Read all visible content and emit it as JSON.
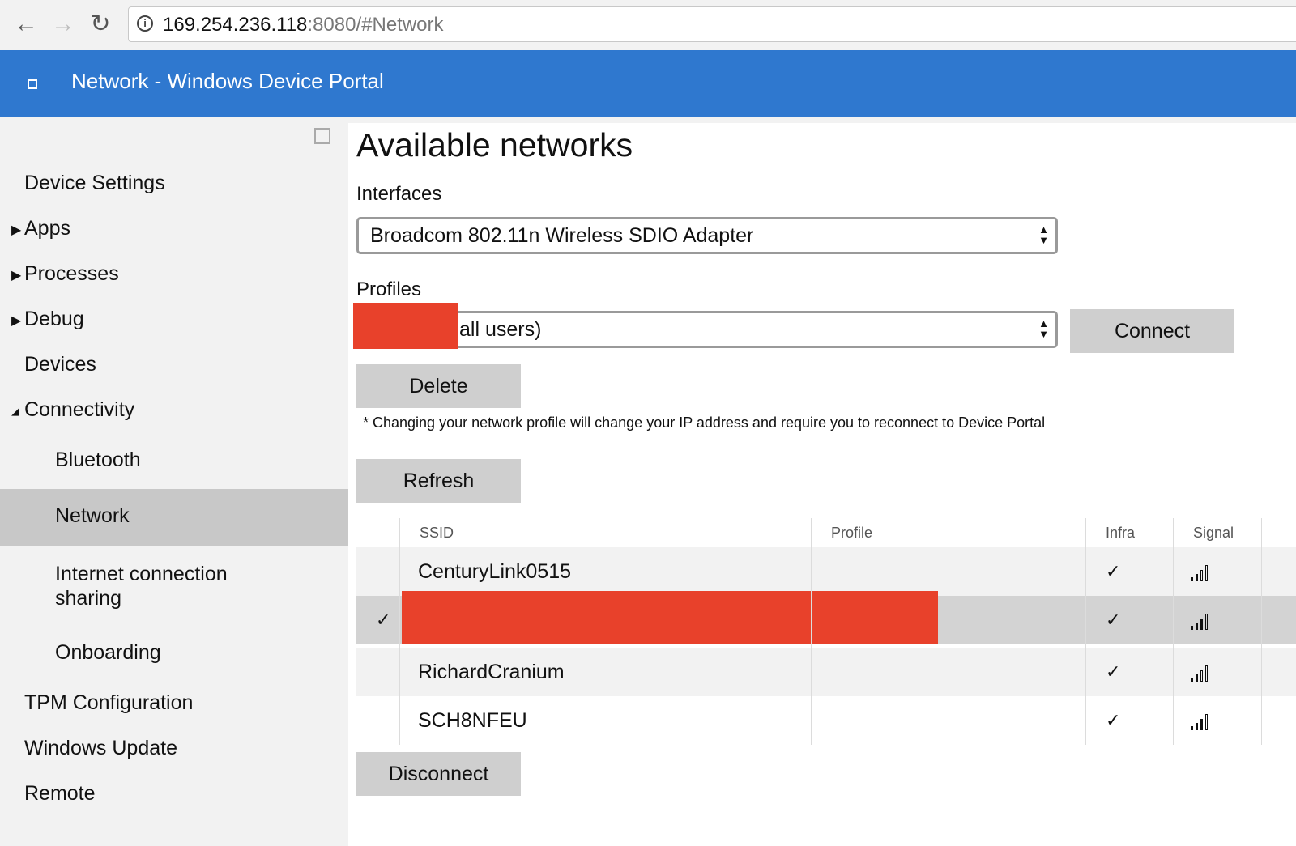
{
  "browser": {
    "url_host": "169.254.236.118",
    "url_rest": ":8080/#Network",
    "back_icon": "←",
    "forward_icon": "→",
    "reload_icon": "↻",
    "info_icon": "i"
  },
  "header": {
    "title": "Network - Windows Device Portal",
    "color": "#2f78cf"
  },
  "sidebar": {
    "items": [
      {
        "label": "Device Settings",
        "arrow": ""
      },
      {
        "label": "Apps",
        "arrow": "▶"
      },
      {
        "label": "Processes",
        "arrow": "▶"
      },
      {
        "label": "Debug",
        "arrow": "▶"
      },
      {
        "label": "Devices",
        "arrow": ""
      },
      {
        "label": "Connectivity",
        "arrow": "◢"
      },
      {
        "label": "Bluetooth",
        "arrow": ""
      },
      {
        "label": "Network",
        "arrow": ""
      },
      {
        "label": "Internet connection\nsharing",
        "arrow": ""
      },
      {
        "label": "Onboarding",
        "arrow": ""
      },
      {
        "label": "TPM Configuration",
        "arrow": ""
      },
      {
        "label": "Windows Update",
        "arrow": ""
      },
      {
        "label": "Remote",
        "arrow": ""
      }
    ]
  },
  "main": {
    "title": "Available networks",
    "interfaces_label": "Interfaces",
    "interface_value": "Broadcom 802.11n Wireless SDIO Adapter",
    "profiles_label": "Profiles",
    "profile_value": "all users)",
    "connect_label": "Connect",
    "delete_label": "Delete",
    "note": "* Changing your network profile will change your IP address and require you to reconnect to Device Portal",
    "refresh_label": "Refresh",
    "disconnect_label": "Disconnect",
    "redaction_color": "#e8412b",
    "table": {
      "headers": [
        "SSID",
        "Profile",
        "Infra",
        "Signal"
      ],
      "rows": [
        {
          "ssid": "CenturyLink0515",
          "profile": "",
          "connected": "",
          "infra": "✓",
          "signal": 2
        },
        {
          "ssid": "",
          "profile": "",
          "connected": "✓",
          "infra": "✓",
          "signal": 3
        },
        {
          "ssid": "RichardCranium",
          "profile": "",
          "connected": "",
          "infra": "✓",
          "signal": 2
        },
        {
          "ssid": "SCH8NFEU",
          "profile": "",
          "connected": "",
          "infra": "✓",
          "signal": 3
        }
      ]
    }
  }
}
